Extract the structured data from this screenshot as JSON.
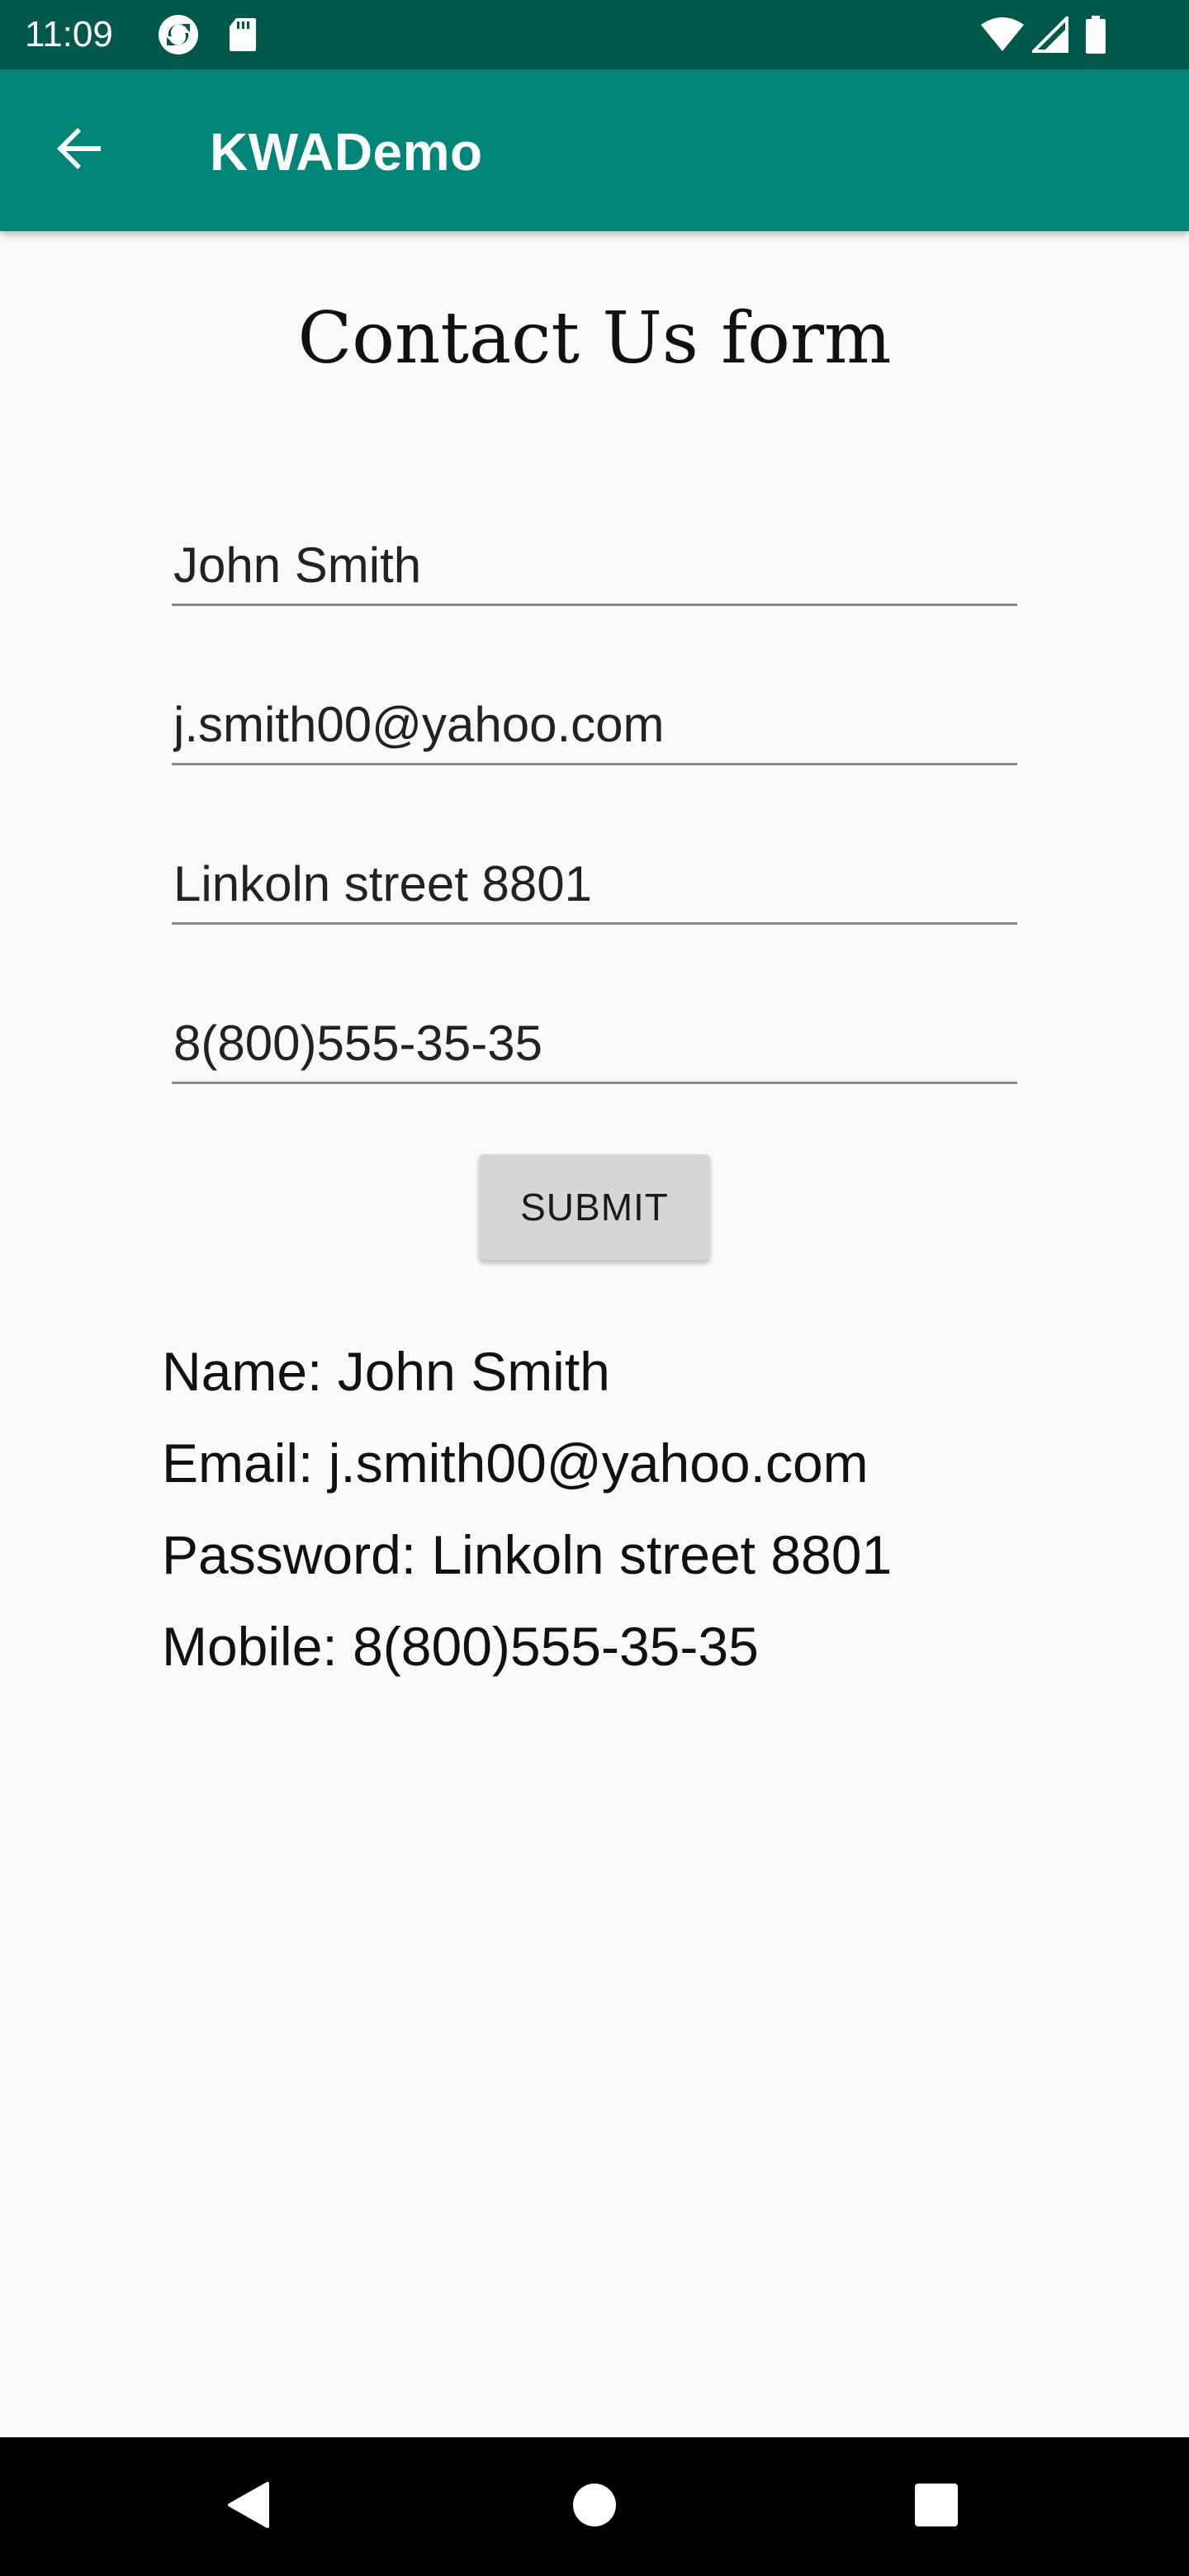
{
  "status_bar": {
    "time": "11:09",
    "left_icons": [
      "sync-icon",
      "sd-card-icon"
    ],
    "right_icons": [
      "wifi-icon",
      "cell-signal-icon",
      "battery-icon"
    ],
    "background": "#00574b"
  },
  "app_bar": {
    "title": "KWADemo",
    "back_icon": "arrow-back-icon",
    "background": "#008577"
  },
  "form": {
    "heading": "Contact Us form",
    "fields": {
      "name": {
        "value": "John Smith"
      },
      "email": {
        "value": "j.smith00@yahoo.com"
      },
      "address": {
        "value": "Linkoln street 8801"
      },
      "mobile": {
        "value": "8(800)555-35-35"
      }
    },
    "submit_label": "SUBMIT"
  },
  "result": {
    "name_line": "Name: John Smith",
    "email_line": "Email: j.smith00@yahoo.com",
    "password_line": "Password: Linkoln street 8801",
    "mobile_line": "Mobile: 8(800)555-35-35"
  },
  "nav_bar": {
    "buttons": [
      "back-triangle-icon",
      "home-circle-icon",
      "recents-square-icon"
    ]
  }
}
